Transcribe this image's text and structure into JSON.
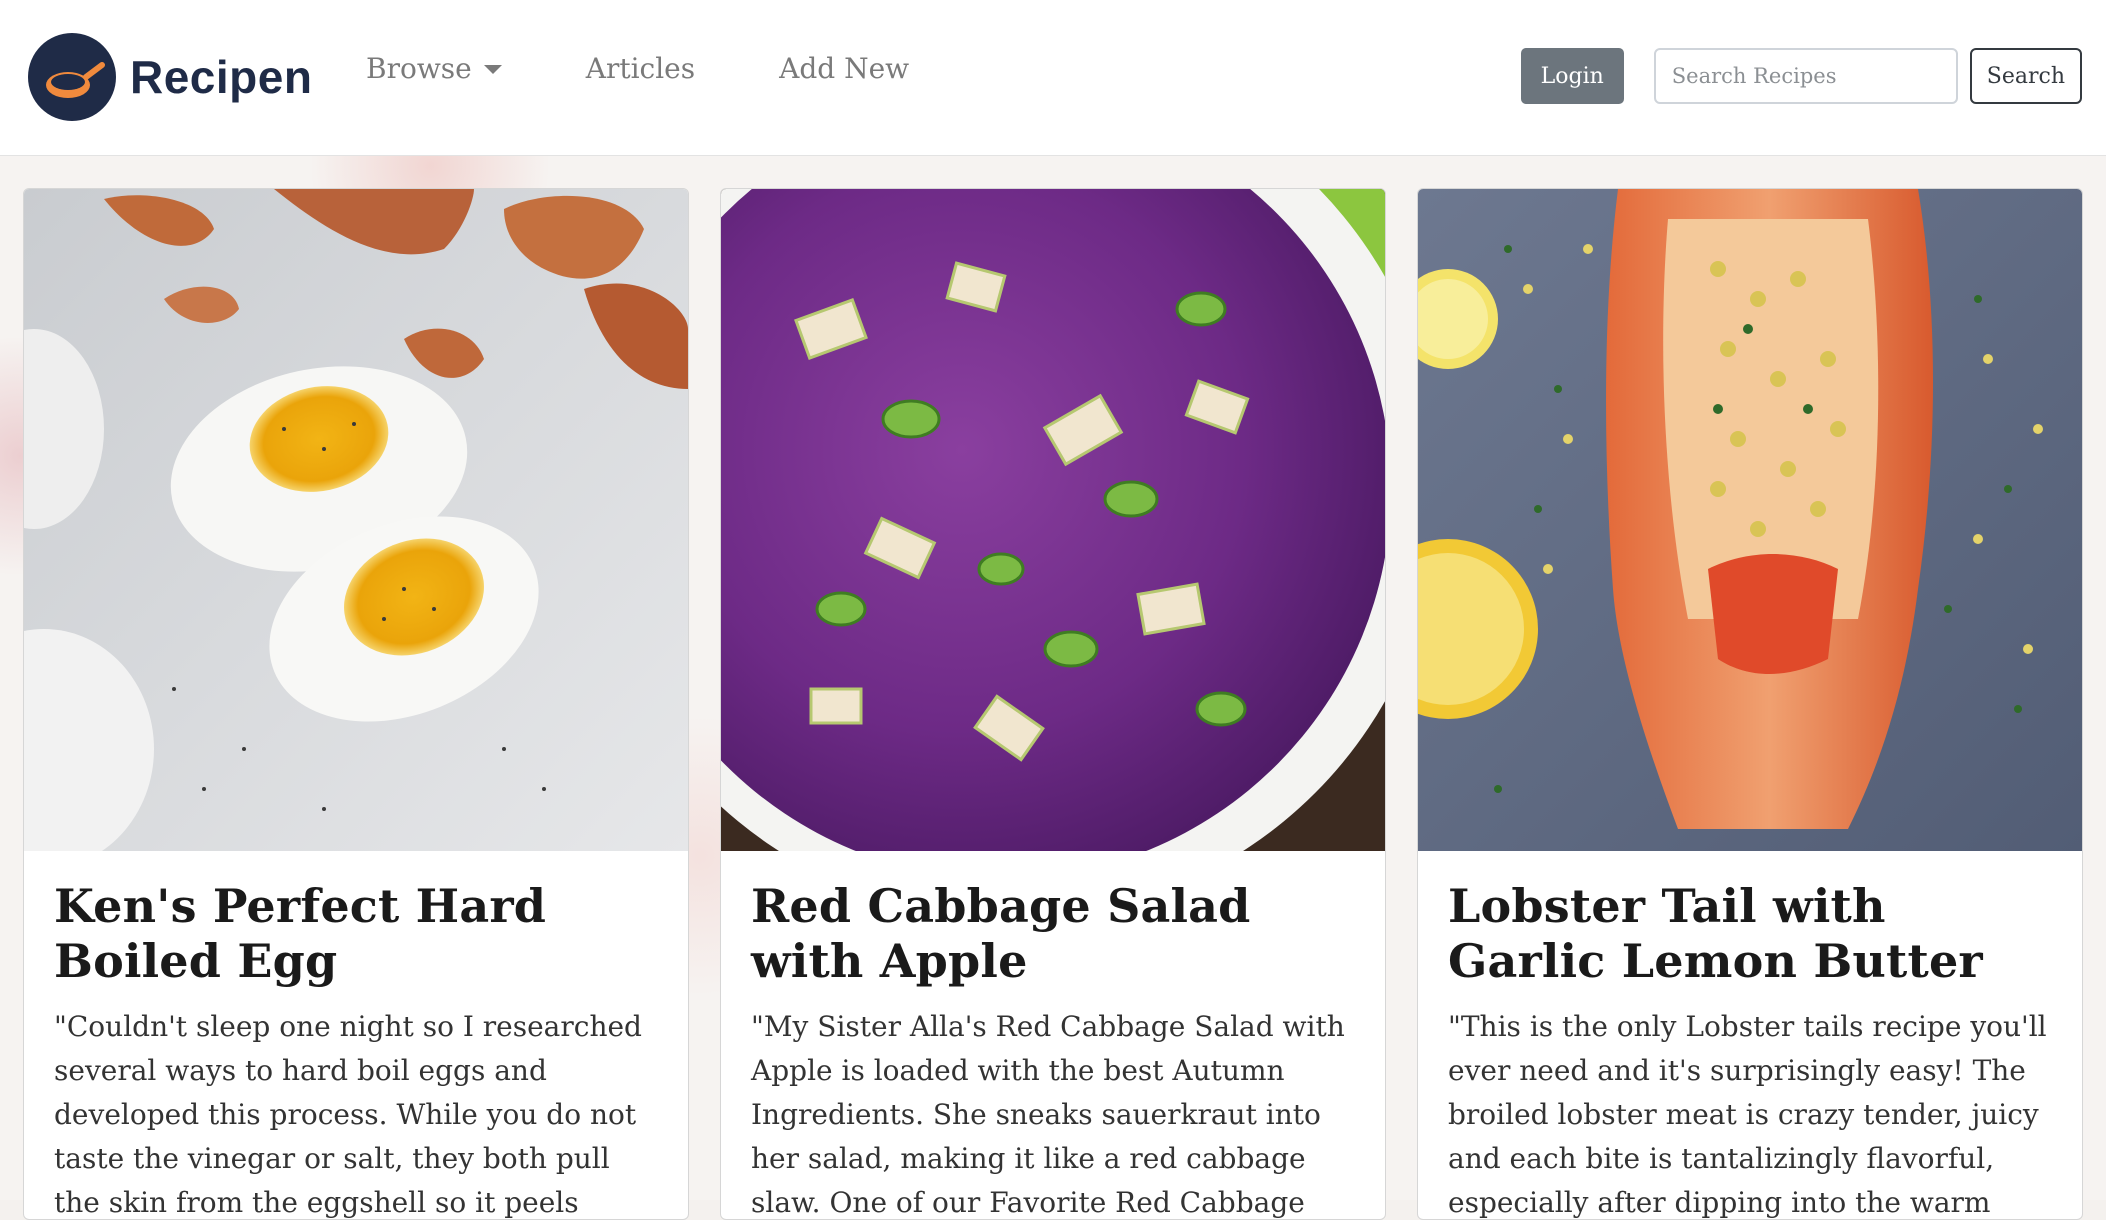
{
  "brand": {
    "name": "Recipen",
    "logo_icon": "frying-pan-icon",
    "logo_bg": "#1f2b47",
    "logo_accent": "#f08a3d"
  },
  "nav": {
    "items": [
      {
        "label": "Browse",
        "has_dropdown": true
      },
      {
        "label": "Articles"
      },
      {
        "label": "Add New"
      }
    ]
  },
  "header": {
    "login_label": "Login",
    "search_placeholder": "Search Recipes",
    "search_button_label": "Search"
  },
  "recipes": [
    {
      "title": "Ken's Perfect Hard Boiled Egg",
      "excerpt": "\"Couldn't sleep one night so I researched several ways to hard boil eggs and developed this process. While you do not taste the vinegar or salt, they both pull the skin from the eggshell so it peels easily without tearing or sticking.",
      "image_subject": "halved hard boiled eggs on grey surface with eggshells"
    },
    {
      "title": "Red Cabbage Salad with Apple",
      "excerpt": "\"My Sister Alla's Red Cabbage Salad with Apple is loaded with the best Autumn Ingredients. She sneaks sauerkraut into her salad, making it like a red cabbage slaw. One of our Favorite Red Cabbage Recipes\"",
      "image_subject": "bowl of shredded red cabbage salad with apple and cucumber"
    },
    {
      "title": "Lobster Tail with Garlic Lemon Butter",
      "excerpt": "\"This is the only Lobster tails recipe you'll ever need and it's surprisingly easy! The broiled lobster meat is crazy tender, juicy and each bite is tantalizingly flavorful, especially after dipping into the warm garlic lemon butter.\"",
      "image_subject": "broiled lobster tail with garlic butter, herbs and lemon slices"
    }
  ]
}
